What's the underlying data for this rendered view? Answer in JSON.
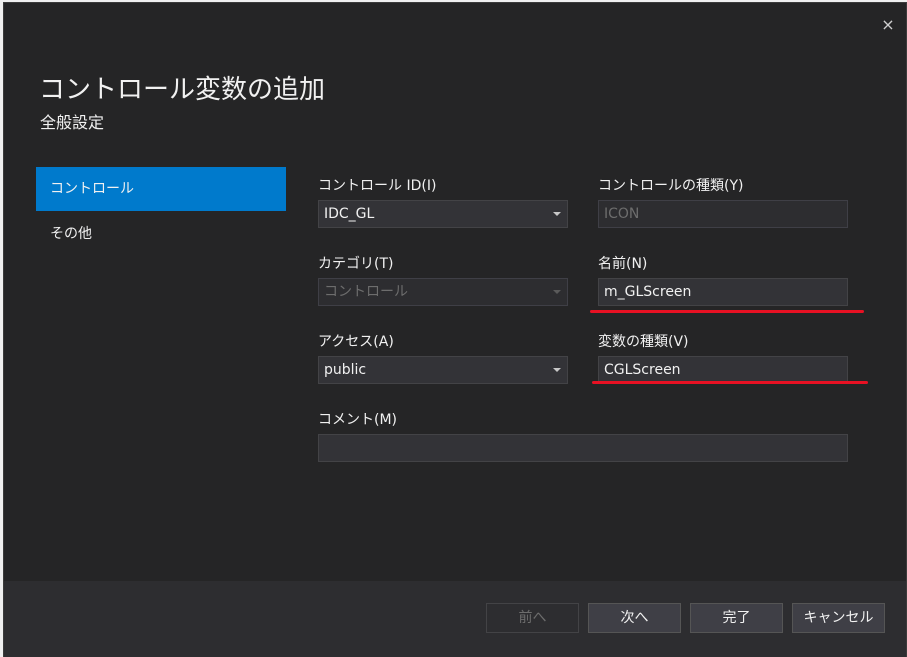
{
  "dialog": {
    "title": "コントロール変数の追加",
    "subtitle": "全般設定",
    "close_icon": "×"
  },
  "nav": {
    "items": [
      {
        "label": "コントロール",
        "selected": true
      },
      {
        "label": "その他",
        "selected": false
      }
    ]
  },
  "form": {
    "control_id": {
      "label": "コントロール ID(I)",
      "value": "IDC_GL"
    },
    "control_type": {
      "label": "コントロールの種類(Y)",
      "value": "ICON"
    },
    "category": {
      "label": "カテゴリ(T)",
      "value": "コントロール"
    },
    "name": {
      "label": "名前(N)",
      "value": "m_GLScreen"
    },
    "access": {
      "label": "アクセス(A)",
      "value": "public"
    },
    "variable_type": {
      "label": "変数の種類(V)",
      "value": "CGLScreen"
    },
    "comment": {
      "label": "コメント(M)",
      "value": ""
    }
  },
  "buttons": {
    "prev": "前へ",
    "next": "次へ",
    "finish": "完了",
    "cancel": "キャンセル"
  },
  "colors": {
    "accent": "#007acc",
    "highlight_underline": "#e81123"
  }
}
